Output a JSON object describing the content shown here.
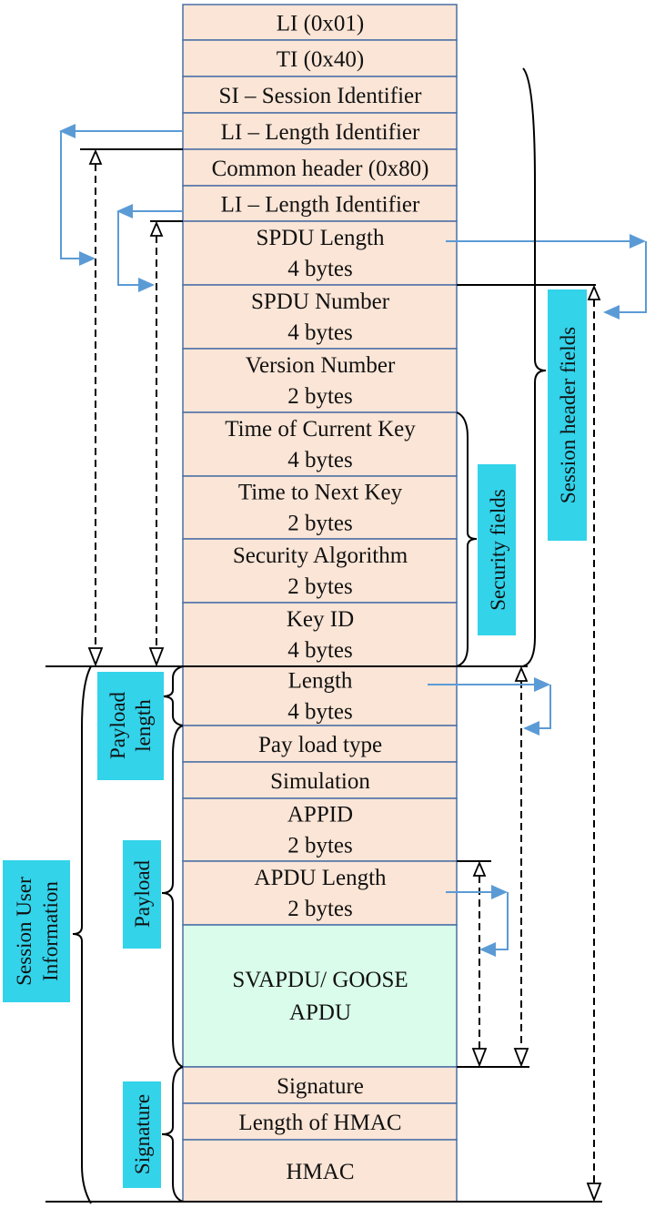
{
  "colors": {
    "field_fill": "#FBE5D6",
    "apdu_fill": "#DAFCEB",
    "cell_border": "#4A6FA5",
    "label_box": "#33D3EA",
    "connector": "#5B9BD5"
  },
  "fields": [
    {
      "name": "LI (0x01)"
    },
    {
      "name": "TI (0x40)"
    },
    {
      "name": "SI – Session Identifier"
    },
    {
      "name": "LI – Length Identifier"
    },
    {
      "name": "Common header (0x80)"
    },
    {
      "name": "LI – Length Identifier"
    },
    {
      "name": "SPDU Length",
      "size": "4 bytes"
    },
    {
      "name": "SPDU Number",
      "size": "4 bytes"
    },
    {
      "name": "Version Number",
      "size": "2 bytes"
    },
    {
      "name": "Time of Current Key",
      "size": "4 bytes"
    },
    {
      "name": "Time to Next Key",
      "size": "2 bytes"
    },
    {
      "name": "Security Algorithm",
      "size": "2 bytes"
    },
    {
      "name": "Key ID",
      "size": "4 bytes"
    },
    {
      "name": "Length",
      "size": "4 bytes"
    },
    {
      "name": "Pay load type"
    },
    {
      "name": "Simulation"
    },
    {
      "name": "APPID",
      "size": "2 bytes"
    },
    {
      "name": "APDU Length",
      "size": "2 bytes"
    },
    {
      "name": "SVAPDU/ GOOSE",
      "size": "APDU"
    },
    {
      "name": "Signature"
    },
    {
      "name": "Length of HMAC"
    },
    {
      "name": "HMAC"
    }
  ],
  "labels": {
    "session_header": "Session header fields",
    "security": "Security fields",
    "payload_length_1": "Payload",
    "payload_length_2": "length",
    "payload": "Payload",
    "signature": "Signature",
    "session_user_1": "Session User",
    "session_user_2": "Information"
  }
}
